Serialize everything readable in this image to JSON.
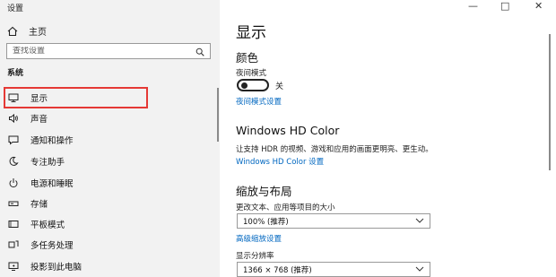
{
  "window": {
    "title": "设置",
    "controls": [
      "—",
      "□",
      "✕"
    ]
  },
  "sidebar": {
    "home_label": "主页",
    "search_placeholder": "查找设置",
    "section_label": "系统",
    "items": [
      {
        "label": "显示",
        "icon": "monitor-icon",
        "selected": true
      },
      {
        "label": "声音",
        "icon": "speaker-icon"
      },
      {
        "label": "通知和操作",
        "icon": "notification-icon"
      },
      {
        "label": "专注助手",
        "icon": "moon-icon"
      },
      {
        "label": "电源和睡眠",
        "icon": "power-icon"
      },
      {
        "label": "存储",
        "icon": "storage-icon"
      },
      {
        "label": "平板模式",
        "icon": "tablet-icon"
      },
      {
        "label": "多任务处理",
        "icon": "multitask-icon"
      },
      {
        "label": "投影到此电脑",
        "icon": "project-icon"
      }
    ]
  },
  "main": {
    "title": "显示",
    "color": {
      "heading": "颜色",
      "night_light_label": "夜间模式",
      "night_light_state": "关",
      "night_light_on": false,
      "night_light_settings_link": "夜间模式设置"
    },
    "hd_color": {
      "heading": "Windows HD Color",
      "description": "让支持 HDR 的视频、游戏和应用的画面更明亮、更生动。",
      "link": "Windows HD Color 设置"
    },
    "scale_layout": {
      "heading": "缩放与布局",
      "scale_label": "更改文本、应用等项目的大小",
      "scale_value": "100% (推荐)",
      "advanced_link": "高级缩放设置",
      "resolution_label": "显示分辨率",
      "resolution_value": "1366 × 768 (推荐)"
    }
  },
  "colors": {
    "accent_link": "#0067c0",
    "highlight": "#e53935",
    "sidebar_bg": "#f2f2f2"
  }
}
